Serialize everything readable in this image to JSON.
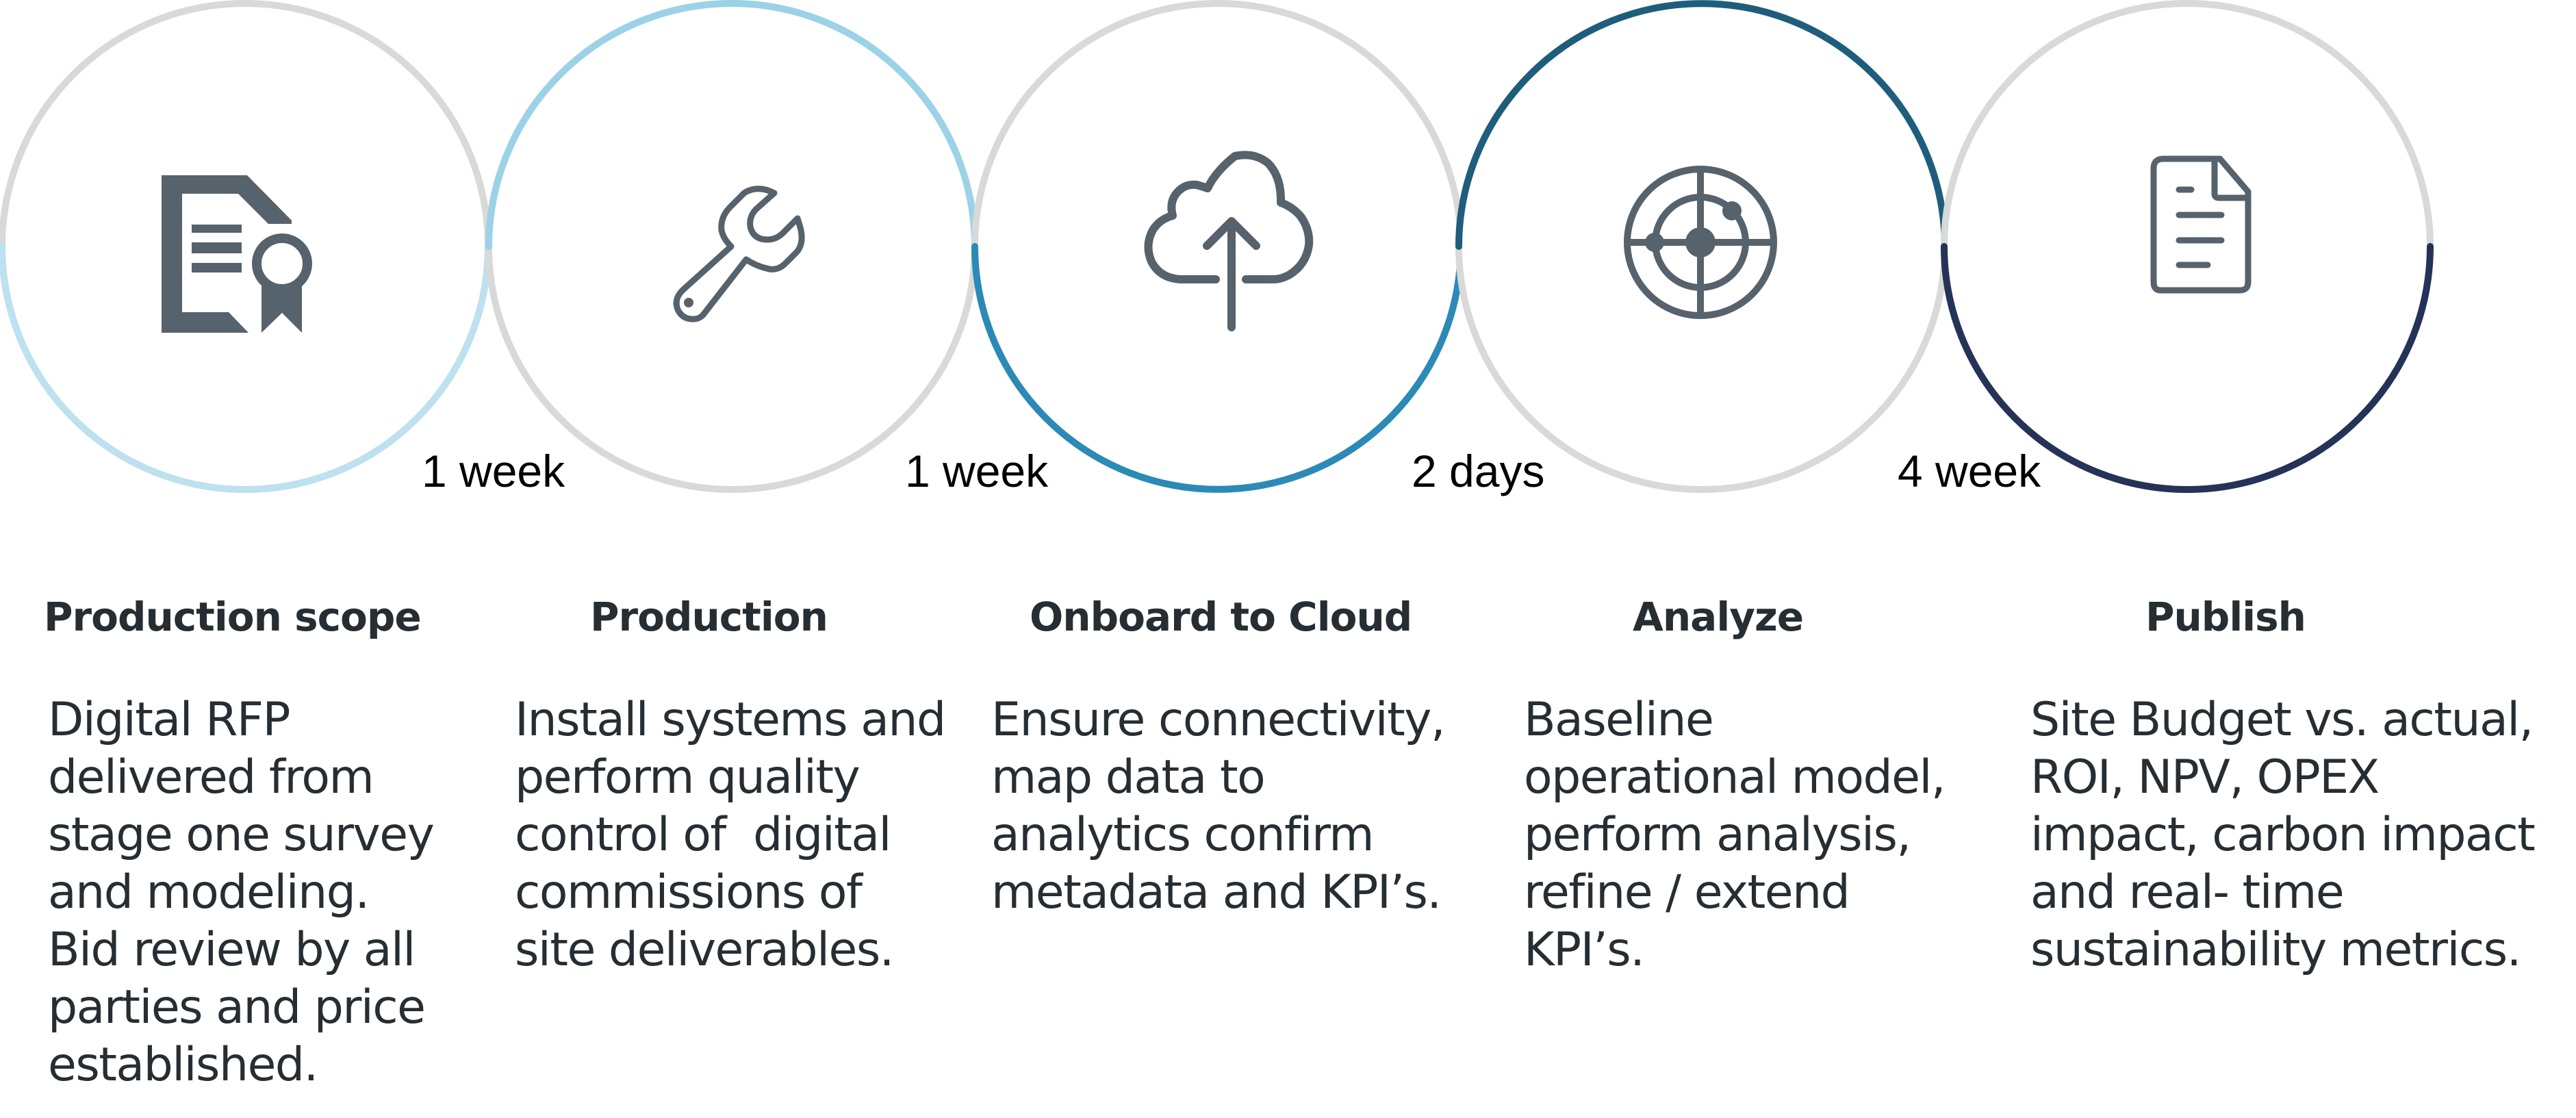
{
  "colors": {
    "ring_base": "#d9d9d9",
    "icon": "#56626c",
    "text": "#262e33",
    "duration_text": "#000000"
  },
  "stages": [
    {
      "title": "Production scope",
      "icon": "certificate-document-icon",
      "accent": "#bde1ee",
      "accent_half": "bottom",
      "description_lines": [
        "Digital RFP",
        "delivered from",
        "stage one survey",
        "and modeling.",
        "Bid review by all",
        "parties and price",
        "established."
      ]
    },
    {
      "title": "Production",
      "icon": "wrench-icon",
      "accent": "#9bd2e8",
      "accent_half": "top",
      "description_lines": [
        "Install systems and",
        "perform quality",
        "control of  digital",
        "commissions of",
        "site deliverables."
      ]
    },
    {
      "title": "Onboard to Cloud",
      "icon": "cloud-upload-icon",
      "accent": "#2b8ab6",
      "accent_half": "bottom",
      "description_lines": [
        "Ensure connectivity,",
        "map data to",
        "analytics confirm",
        "metadata and KPI’s."
      ]
    },
    {
      "title": "Analyze",
      "icon": "radar-target-icon",
      "accent": "#1e5e7c",
      "accent_half": "top",
      "description_lines": [
        "Baseline",
        "operational model,",
        "perform analysis,",
        "refine / extend",
        "KPI’s."
      ]
    },
    {
      "title": "Publish",
      "icon": "document-icon",
      "accent": "#243357",
      "accent_half": "bottom",
      "description_lines": [
        "Site Budget vs. actual,",
        "ROI, NPV, OPEX",
        "impact, carbon impact",
        "and real- time",
        "sustainability metrics."
      ]
    }
  ],
  "durations": [
    "1 week",
    "1 week",
    "2 days",
    "4 week"
  ]
}
